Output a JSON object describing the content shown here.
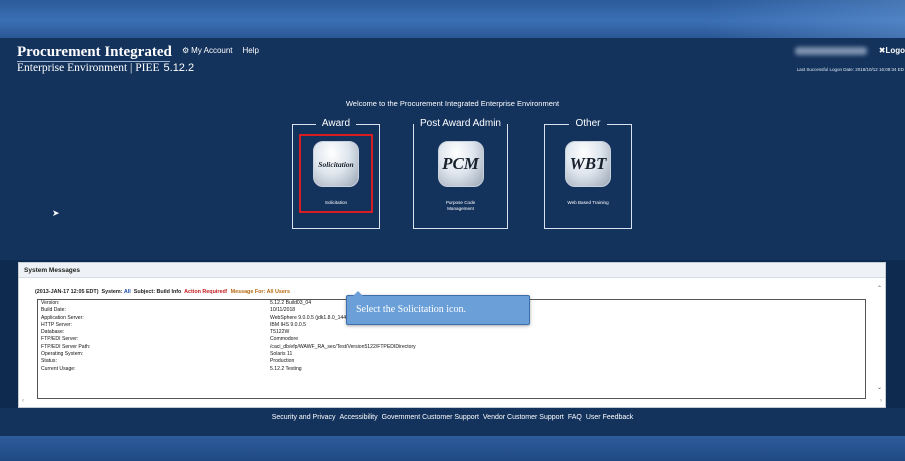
{
  "header": {
    "title": "Procurement Integrated",
    "subtitle": "Enterprise Environment | PIEE",
    "version": "5.12.2",
    "nav": {
      "my_account": "My Account",
      "help": "Help"
    },
    "logout": "Logo",
    "last_logon": "Last Successful Logon Date: 2018/10/12 16:09:34 ED"
  },
  "welcome": "Welcome to the Procurement Integrated Enterprise Environment",
  "groups": [
    {
      "title": "Award",
      "icon_text": "Solicitation",
      "label": "Solicitation"
    },
    {
      "title": "Post Award Admin",
      "icon_text": "PCM",
      "label": "Purpose Code\nManagement"
    },
    {
      "title": "Other",
      "icon_text": "WBT",
      "label": "Web Based Training"
    }
  ],
  "system_messages": {
    "heading": "System Messages",
    "date": "(2013-JAN-17 12:05 EDT)",
    "system_label": "System:",
    "system_value": "All",
    "subject": "Subject: Build Info",
    "action": "Action Required!",
    "message_for": "Message For: All Users",
    "rows": [
      {
        "k": "Version:",
        "v": "5.12.2 Build03_04"
      },
      {
        "k": "Build Date:",
        "v": "10/11/2018"
      },
      {
        "k": "Application Server:",
        "v": "WebSphere 9.0.0.5 (jdk1.8.0_144)"
      },
      {
        "k": "HTTP Server:",
        "v": "IBM IHS 9.0.0.5"
      },
      {
        "k": "Database:",
        "v": "T5122W"
      },
      {
        "k": "FTP/EDI Server:",
        "v": "Commodore"
      },
      {
        "k": "FTP/EDI Server Path:",
        "v": "/caci_db/efp/WAWF_RA_sec/Test/Version5122/FTPEDIDirectory"
      },
      {
        "k": "Operating System:",
        "v": "Solaris 11"
      },
      {
        "k": "Status:",
        "v": "Production"
      },
      {
        "k": "Current Usage:",
        "v": "5.12.2 Testing"
      }
    ]
  },
  "tooltip": "Select the Solicitation icon.",
  "footer": [
    "Security and Privacy",
    "Accessibility",
    "Government Customer Support",
    "Vendor Customer Support",
    "FAQ",
    "User Feedback"
  ],
  "colors": {
    "background": "#13325c",
    "highlight": "#d71d22",
    "tooltip": "#6a9fd8"
  }
}
